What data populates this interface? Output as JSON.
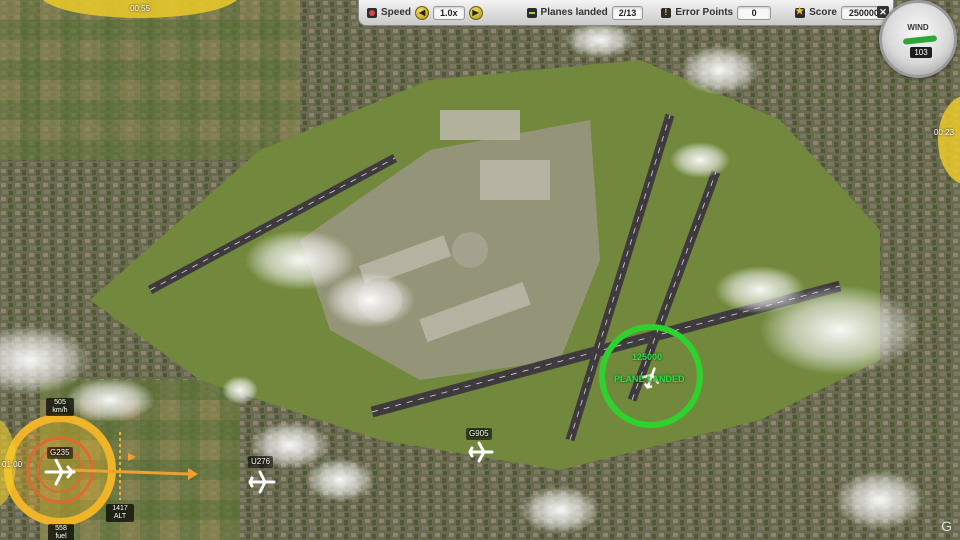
{
  "hud": {
    "speed_label": "Speed",
    "speed_value": "1.0x",
    "speed_down": "◀",
    "speed_up": "▶",
    "planes_label": "Planes landed",
    "planes_value": "2/13",
    "error_label": "Error Points",
    "error_value": "0",
    "score_label": "Score",
    "score_value": "250000",
    "close": "✕"
  },
  "wind": {
    "label": "WIND",
    "value": "103"
  },
  "timers": {
    "top": "00:55",
    "right": "00:23",
    "left": "01:00"
  },
  "planes": {
    "selected": {
      "callsign": "G235",
      "speed": "505",
      "speed_unit": "km/h",
      "altitude": "1417",
      "alt_unit": "ALT",
      "fuel": "558",
      "fuel_unit": "fuel"
    },
    "u276": {
      "callsign": "U276"
    },
    "g905": {
      "callsign": "G905"
    },
    "landed": {
      "points": "125000",
      "message": "PLANE LANDED"
    }
  },
  "watermark": "G",
  "colors": {
    "runway": "#3e3a3e",
    "grass": "#6f8a3a",
    "landed_ring": "#2ed12e",
    "timer": "#f0cd28"
  }
}
